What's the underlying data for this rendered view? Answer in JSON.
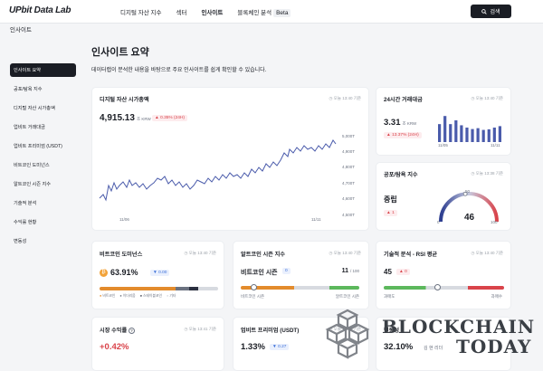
{
  "header": {
    "logo": "UPbit Data Lab",
    "nav": [
      "디지털 자산 지수",
      "섹터",
      "인사이트",
      "블록체인 분석"
    ],
    "beta": "Beta",
    "search": "검색"
  },
  "sidebar": {
    "title": "인사이트",
    "items": [
      "인사이트 요약",
      "공포/탐욕 지수",
      "디지털 자산 시가총액",
      "업비트 거래대금",
      "업비트 프리미엄 (USDT)",
      "비트코인 도미넌스",
      "알트코인 시즌 지수",
      "기술적 분석",
      "수익률 현황",
      "변동성"
    ]
  },
  "page": {
    "title": "인사이트 요약",
    "desc": "데이터랩이 분석한 내용을 바탕으로 주요 인사이트를 쉽게 확인할 수 있습니다."
  },
  "marketcap": {
    "title": "디지털 자산 시가총액",
    "time": "오늘 13:40 기준",
    "value": "4,915.13",
    "unit": "조 KRW",
    "change": "▲ 0.35% (24H)",
    "yticks": [
      "5,000T",
      "4,900T",
      "4,800T",
      "4,700T",
      "4,600T",
      "4,500T"
    ],
    "xticks": [
      "11/06",
      "11/11"
    ]
  },
  "volume": {
    "title": "24시간 거래대금",
    "time": "오늘 13:40 기준",
    "value": "3.31",
    "unit": "조 KRW",
    "change": "▲ 13.37% (24H)",
    "xticks": [
      "11/05",
      "11/11"
    ],
    "bars": [
      0.62,
      0.9,
      0.62,
      0.75,
      0.58,
      0.5,
      0.45,
      0.48,
      0.42,
      0.44,
      0.5,
      0.55
    ]
  },
  "fear": {
    "title": "공포/탐욕 지수",
    "time": "오늘 13:38 기준",
    "label": "중립",
    "change": "▲ 1",
    "value": "46",
    "gauge_min": "0",
    "gauge_mid": "50",
    "gauge_max": "100"
  },
  "dominance": {
    "title": "비트코인 도미넌스",
    "time": "오늘 13:40 기준",
    "value": "63.91%",
    "change": "▼ 0.00",
    "legend": [
      "비트코인",
      "이더리움",
      "스테이블코인",
      "기타"
    ],
    "shares": [
      0.639,
      0.12,
      0.07,
      0.171
    ]
  },
  "altseason": {
    "title": "알트코인 시즌 지수",
    "time": "오늘 13:40 기준",
    "label": "비트코인 시즌",
    "badge": "0",
    "score": "11",
    "max": "/ 100",
    "left": "비트코인 시즌",
    "right": "알트코인 시즌",
    "level": 0.11
  },
  "rsi": {
    "title": "기술적 분석 - RSI 평균",
    "time": "오늘 13:40 기준",
    "value": "45",
    "change": "▲ 0",
    "left": "과매도",
    "right": "과매수",
    "level": 0.45
  },
  "returns": {
    "title": "시장 수익률",
    "time": "오늘 13:41 기준",
    "value": "+0.42%"
  },
  "premium": {
    "title": "업비트 프리미엄 (USDT)",
    "time": "오늘 13:40 기준",
    "value": "1.33%",
    "change": "▼ 0.27"
  },
  "volatility": {
    "title": "변동성",
    "value": "32.10%",
    "sub": "김 현 리더"
  },
  "watermark": {
    "line1": "BLOCKCHAIN",
    "line2": "TODAY"
  },
  "colors": {
    "accent": "#d9434a",
    "blue": "#3b6fd9",
    "dark": "#1a1d24",
    "bar": "#4a5bab"
  }
}
